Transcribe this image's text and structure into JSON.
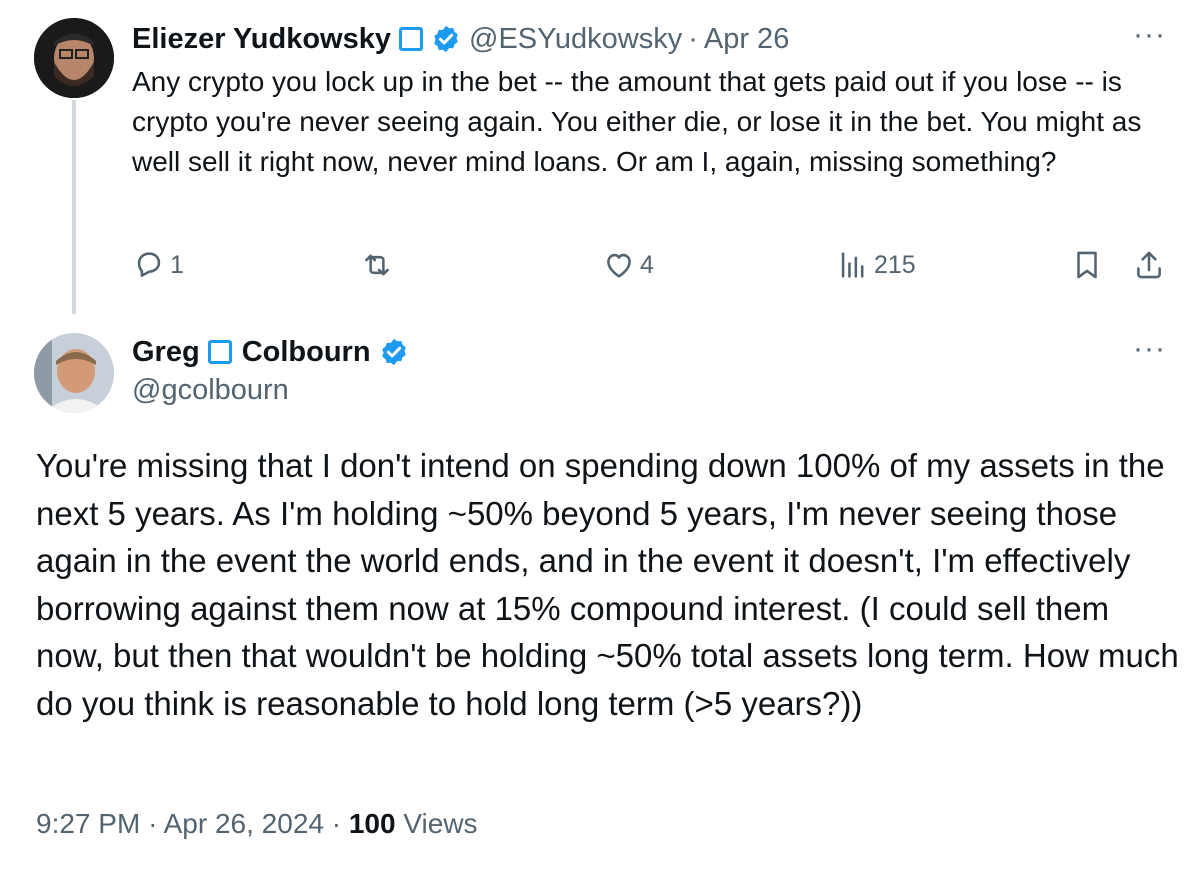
{
  "colors": {
    "accent": "#1d9bf0",
    "muted_text": "#536471",
    "text": "#0f1419",
    "thread_line": "#cfd9de"
  },
  "icons": [
    "square-emoji-icon",
    "verified-badge-icon",
    "more-icon",
    "reply-icon",
    "retweet-icon",
    "like-icon",
    "views-icon",
    "bookmark-icon",
    "share-icon"
  ],
  "tweet1": {
    "name": "Eliezer Yudkowsky",
    "handle": "@ESYudkowsky",
    "separator": "·",
    "date": "Apr 26",
    "more": "···",
    "text": "Any crypto you lock up in the bet -- the amount that gets paid out if you lose -- is crypto you're never seeing again.  You either die, or lose it in the bet.  You might as well sell it right now, never mind loans.  Or am I, again, missing something?",
    "replies": "1",
    "likes": "4",
    "views": "215"
  },
  "tweet2": {
    "name_first": "Greg",
    "name_last": "Colbourn",
    "handle": "@gcolbourn",
    "more": "···",
    "text": "You're missing that I don't intend on spending down 100% of my assets in the next 5 years. As I'm holding ~50% beyond 5 years, I'm never seeing those again in the event the world ends, and in the event it doesn't, I'm effectively borrowing against them now at 15% compound interest. (I could sell them now, but then that wouldn't be holding ~50% total assets long term. How much do you think is reasonable to hold long term (>5 years?))",
    "time": "9:27 PM",
    "date": "Apr 26, 2024",
    "separator": "·",
    "views_count": "100",
    "views_label": "Views"
  }
}
